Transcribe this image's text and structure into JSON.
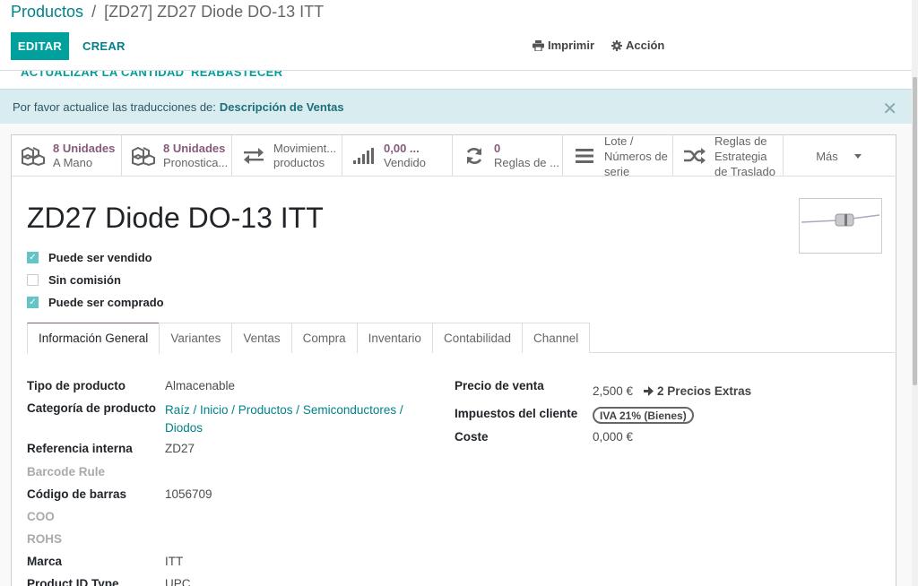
{
  "breadcrumb": {
    "parent": "Productos",
    "separator": "/",
    "current": "[ZD27] ZD27 Diode DO-13 ITT"
  },
  "toolbar": {
    "edit_label": "EDITAR",
    "create_label": "CREAR",
    "print_label": "Imprimir",
    "action_label": "Acción"
  },
  "statusbar": {
    "update_qty": "ACTUALIZAR LA CANTIDAD",
    "replenish": "REABASTECER"
  },
  "alert": {
    "text": "Por favor actualice las traducciones de:",
    "field": "Descripción de Ventas",
    "close": "✕"
  },
  "buttonbox": {
    "on_hand": {
      "value": "8 Unidades",
      "label": "A Mano",
      "icon": "cubes-icon"
    },
    "forecast": {
      "value": "8 Unidades",
      "label": "Pronostica...",
      "icon": "cubes-icon"
    },
    "moves": {
      "line1": "Movimient...",
      "line2": "productos",
      "icon": "exchange-icon"
    },
    "sold": {
      "value": "0,00 ...",
      "label": "Vendido",
      "icon": "signal-icon"
    },
    "rules": {
      "value": "0",
      "label": "Reglas de ...",
      "icon": "refresh-icon"
    },
    "lots": {
      "text": "Lote / Números de serie",
      "icon": "bars-icon"
    },
    "putaway": {
      "text": "Reglas de Estrategia de Traslado",
      "icon": "random-icon"
    },
    "more": "Más"
  },
  "product": {
    "name": "ZD27 Diode DO-13 ITT",
    "checkboxes": [
      {
        "label": "Puede ser vendido",
        "checked": true
      },
      {
        "label": "Sin comisión",
        "checked": false
      },
      {
        "label": "Puede ser comprado",
        "checked": true
      }
    ]
  },
  "tabs": [
    "Información General",
    "Variantes",
    "Ventas",
    "Compra",
    "Inventario",
    "Contabilidad",
    "Channel"
  ],
  "left_fields": {
    "tipo_label": "Tipo de producto",
    "tipo_value": "Almacenable",
    "categoria_label": "Categoría de producto",
    "categoria_line1": "Raíz / Inicio / Productos / Semiconductores /",
    "categoria_line2": "Diodos",
    "ref_label": "Referencia interna",
    "ref_value": "ZD27",
    "barcode_rule_label": "Barcode Rule",
    "barcode_label": "Código de barras",
    "barcode_value": "1056709",
    "coo_label": "COO",
    "rohs_label": "ROHS",
    "marca_label": "Marca",
    "marca_value": "ITT",
    "pid_label": "Product ID Type",
    "pid_value": "UPC"
  },
  "right_fields": {
    "precio_label": "Precio de venta",
    "precio_value": "2,500 €",
    "extra_prices": "2 Precios Extras",
    "impuestos_label": "Impuestos del cliente",
    "impuestos_tag": "IVA 21% (Bienes)",
    "coste_label": "Coste",
    "coste_value": "0,000 €"
  },
  "colors": {
    "primary": "#00a09d",
    "link": "#00828a",
    "stat_value": "#875a7b",
    "alert_bg": "#d9ecef"
  }
}
